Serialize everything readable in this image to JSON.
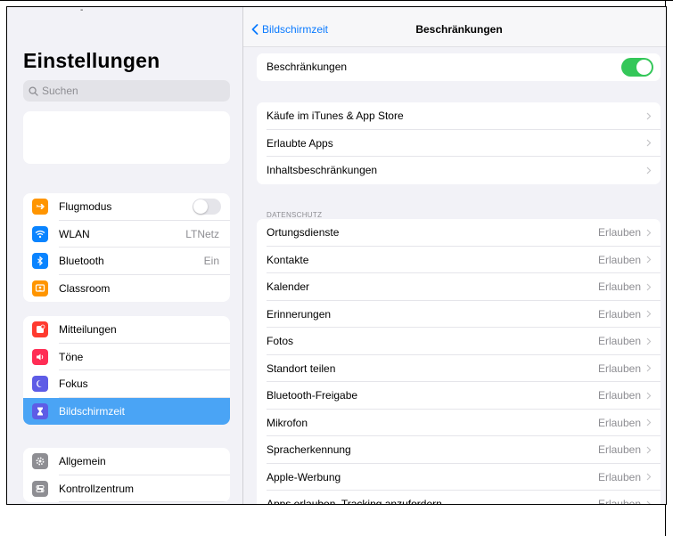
{
  "sidebar": {
    "title": "Einstellungen",
    "search_placeholder": "Suchen",
    "group1": [
      {
        "label": "Flugmodus",
        "icon": "airplane-icon",
        "color": "#ff9500",
        "value": ""
      },
      {
        "label": "WLAN",
        "icon": "wifi-icon",
        "color": "#0a84ff",
        "value": "LTNetz"
      },
      {
        "label": "Bluetooth",
        "icon": "bluetooth-icon",
        "color": "#0a84ff",
        "value": "Ein"
      },
      {
        "label": "Classroom",
        "icon": "classroom-icon",
        "color": "#ff9500",
        "value": ""
      }
    ],
    "group2": [
      {
        "label": "Mitteilungen",
        "icon": "notifications-icon",
        "color": "#ff3b30"
      },
      {
        "label": "Töne",
        "icon": "sound-icon",
        "color": "#ff2d55"
      },
      {
        "label": "Fokus",
        "icon": "moon-icon",
        "color": "#5e5ce6"
      },
      {
        "label": "Bildschirmzeit",
        "icon": "hourglass-icon",
        "color": "#5e5ce6"
      }
    ],
    "group3": [
      {
        "label": "Allgemein",
        "icon": "gear-icon",
        "color": "#8e8e93"
      },
      {
        "label": "Kontrollzentrum",
        "icon": "control-center-icon",
        "color": "#8e8e93"
      }
    ],
    "airplane_mode_on": false
  },
  "nav": {
    "back_label": "Bildschirmzeit",
    "title": "Beschränkungen"
  },
  "restrictions": {
    "label": "Beschränkungen",
    "enabled": true
  },
  "purchase_group": [
    {
      "label": "Käufe im iTunes & App Store"
    },
    {
      "label": "Erlaubte Apps"
    },
    {
      "label": "Inhaltsbeschränkungen"
    }
  ],
  "privacy": {
    "header": "DATENSCHUTZ",
    "items": [
      {
        "label": "Ortungsdienste",
        "value": "Erlauben"
      },
      {
        "label": "Kontakte",
        "value": "Erlauben"
      },
      {
        "label": "Kalender",
        "value": "Erlauben"
      },
      {
        "label": "Erinnerungen",
        "value": "Erlauben"
      },
      {
        "label": "Fotos",
        "value": "Erlauben"
      },
      {
        "label": "Standort teilen",
        "value": "Erlauben"
      },
      {
        "label": "Bluetooth-Freigabe",
        "value": "Erlauben"
      },
      {
        "label": "Mikrofon",
        "value": "Erlauben"
      },
      {
        "label": "Spracherkennung",
        "value": "Erlauben"
      },
      {
        "label": "Apple-Werbung",
        "value": "Erlauben"
      },
      {
        "label": "Apps erlauben, Tracking anzufordern",
        "value": "Erlauben"
      }
    ]
  },
  "colors": {
    "accent": "#0a7aff",
    "toggle_on": "#34c759",
    "sidebar_selected": "#4aa4f5"
  }
}
